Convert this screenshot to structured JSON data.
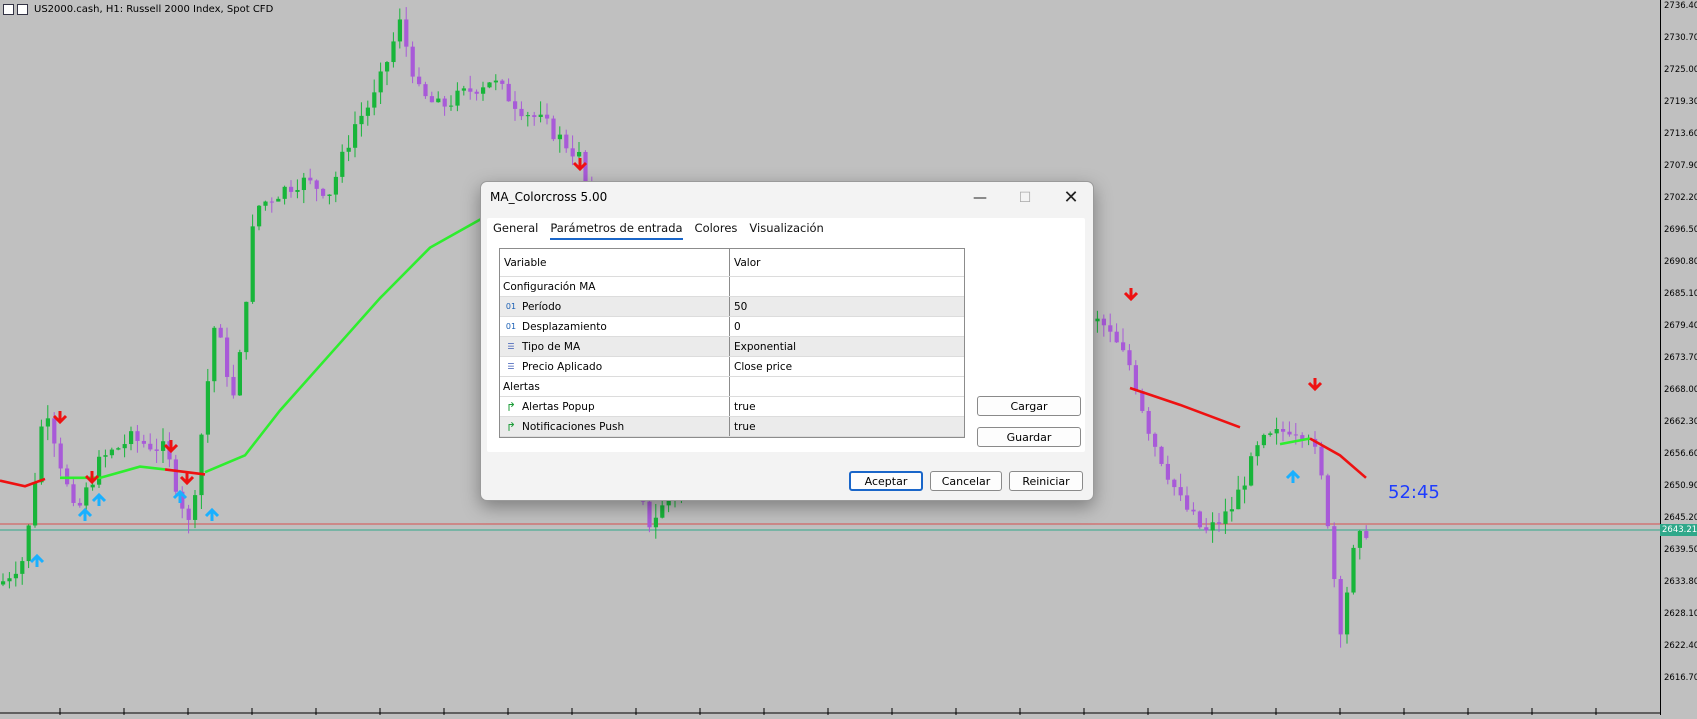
{
  "chart": {
    "header_title": "US2000.cash, H1:  Russell 2000 Index, Spot CFD",
    "countdown": "52:45",
    "current_price": "2643.21",
    "price_ticks": [
      "2736.40",
      "2730.70",
      "2725.00",
      "2719.30",
      "2713.60",
      "2707.90",
      "2702.20",
      "2696.50",
      "2690.80",
      "2685.10",
      "2679.40",
      "2673.70",
      "2668.00",
      "2662.30",
      "2656.60",
      "2650.90",
      "2645.20",
      "2639.50",
      "2633.80",
      "2628.10",
      "2622.40",
      "2616.70"
    ],
    "colors": {
      "bull": "#18b53a",
      "bear": "#a85ad8",
      "ma_up": "#2eee2e",
      "ma_down": "#ee1111",
      "arrow_up": "#1ab0ff",
      "arrow_down": "#ee1111",
      "bid_line": "#d85050",
      "ask_line": "#2fa88a"
    }
  },
  "dialog": {
    "title": "MA_Colorcross 5.00",
    "window_controls": {
      "minimize": "minimize-icon",
      "maximize": "maximize-icon",
      "close": "close-icon"
    },
    "tabs": [
      "General",
      "Parámetros de entrada",
      "Colores",
      "Visualización"
    ],
    "active_tab": "Parámetros de entrada",
    "table": {
      "col_variable": "Variable",
      "col_value": "Valor",
      "rows": [
        {
          "type": "group",
          "label": "Configuración MA",
          "value": ""
        },
        {
          "type": "int",
          "icon": "int-icon",
          "label": "Período",
          "value": "50"
        },
        {
          "type": "int",
          "icon": "int-icon",
          "label": "Desplazamiento",
          "value": "0"
        },
        {
          "type": "enum",
          "icon": "enum-icon",
          "label": "Tipo de MA",
          "value": "Exponential"
        },
        {
          "type": "enum",
          "icon": "enum-icon",
          "label": "Precio Aplicado",
          "value": "Close price"
        },
        {
          "type": "group",
          "label": "Alertas",
          "value": ""
        },
        {
          "type": "bool",
          "icon": "bool-icon",
          "label": "Alertas Popup",
          "value": "true"
        },
        {
          "type": "bool",
          "icon": "bool-icon",
          "label": "Notificaciones Push",
          "value": "true"
        }
      ]
    },
    "side_buttons": {
      "load": "Cargar",
      "save": "Guardar"
    },
    "footer_buttons": {
      "ok": "Aceptar",
      "cancel": "Cancelar",
      "reset": "Reiniciar"
    }
  }
}
